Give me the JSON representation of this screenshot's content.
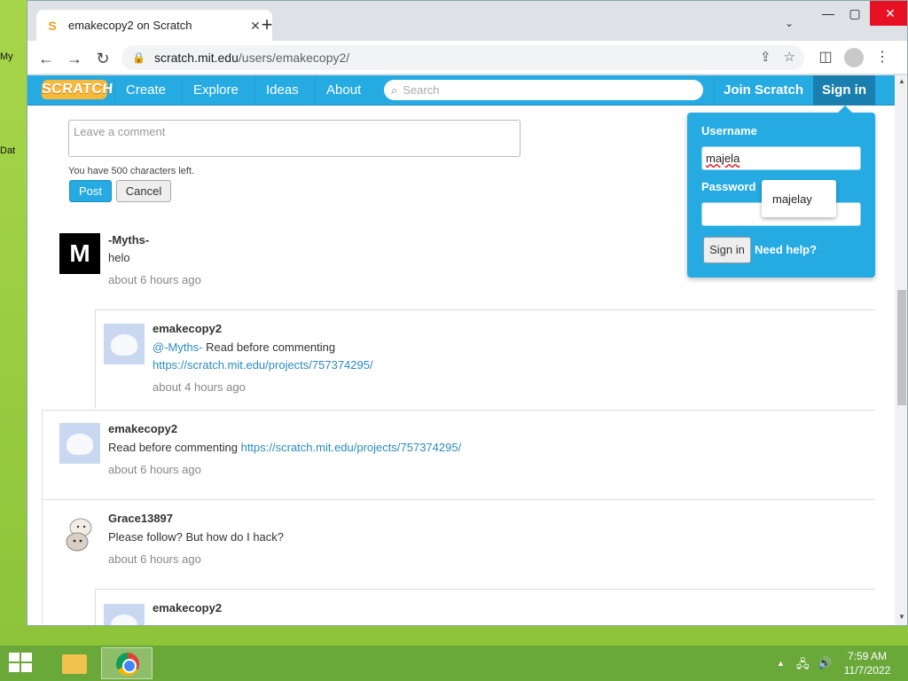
{
  "browser": {
    "tab_title": "emakecopy2 on Scratch",
    "url_host": "scratch.mit.edu",
    "url_path": "/users/emakecopy2/"
  },
  "nav": {
    "logo": "SCRATCH",
    "links": [
      "Create",
      "Explore",
      "Ideas",
      "About"
    ],
    "search_placeholder": "Search",
    "join": "Join Scratch",
    "signin": "Sign in"
  },
  "comment_form": {
    "placeholder": "Leave a comment",
    "chars_left": "You have 500 characters left.",
    "post": "Post",
    "cancel": "Cancel"
  },
  "comments": [
    {
      "user": "-Myths-",
      "text": "helo",
      "time": "about 6 hours ago"
    },
    {
      "user": "emakecopy2",
      "mention": "@-Myths-",
      "text": " Read before commenting",
      "link": "https://scratch.mit.edu/projects/757374295/",
      "time": "about 4 hours ago"
    },
    {
      "user": "emakecopy2",
      "text": "Read before commenting ",
      "link": "https://scratch.mit.edu/projects/757374295/",
      "time": "about 6 hours ago"
    },
    {
      "user": "Grace13897",
      "text": "Please follow? But how do I hack?",
      "time": "about 6 hours ago"
    },
    {
      "user": "emakecopy2"
    }
  ],
  "login": {
    "username_label": "Username",
    "username_value": "majela",
    "password_label": "Password",
    "signin_button": "Sign in",
    "help": "Need help?",
    "autocomplete_suggestion": "majelay"
  },
  "desktop": {
    "icon_labels": [
      "My",
      "Dat"
    ]
  },
  "taskbar": {
    "time": "7:59 AM",
    "date": "11/7/2022"
  },
  "colors": {
    "scratch_blue": "#25aae1",
    "desktop_green": "#8fcb3c",
    "link": "#2a8bbf"
  }
}
